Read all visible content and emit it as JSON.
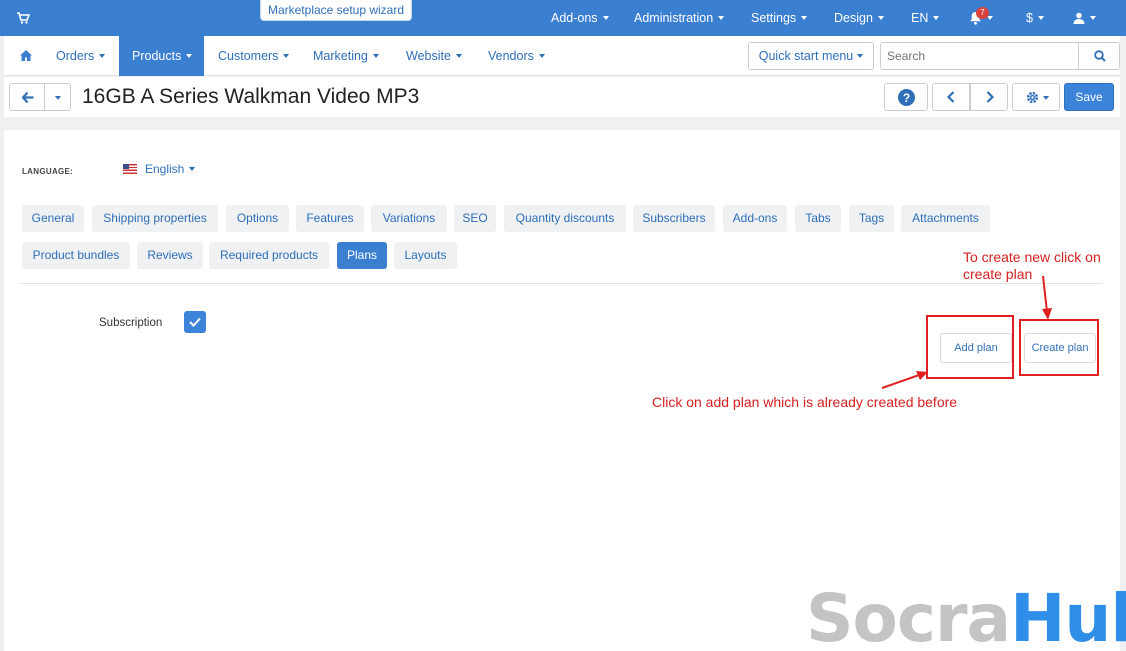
{
  "topbar": {
    "wizard_label": "Marketplace setup wizard",
    "items": [
      "Add-ons",
      "Administration",
      "Settings",
      "Design",
      "EN"
    ],
    "notification_count": "7",
    "currency_label": "$"
  },
  "mainnav": {
    "items": [
      "Orders",
      "Products",
      "Customers",
      "Marketing",
      "Website",
      "Vendors"
    ],
    "quick_start": "Quick start menu",
    "search_placeholder": "Search"
  },
  "titlebar": {
    "title": "16GB A Series Walkman Video MP3",
    "save_label": "Save"
  },
  "content": {
    "language_label": "LANGUAGE:",
    "language_value": "English",
    "tabs_row1": [
      "General",
      "Shipping properties",
      "Options",
      "Features",
      "Variations",
      "SEO",
      "Quantity discounts",
      "Subscribers",
      "Add-ons",
      "Tabs",
      "Tags",
      "Attachments"
    ],
    "tabs_row2": [
      "Product bundles",
      "Reviews",
      "Required products",
      "Plans",
      "Layouts"
    ],
    "active_tab": "Plans",
    "subscription_label": "Subscription",
    "subscription_checked": true,
    "add_plan_label": "Add plan",
    "create_plan_label": "Create plan"
  },
  "annotations": {
    "create_note_line1": "To create new click on",
    "create_note_line2": "create plan",
    "add_note": "Click on add plan which is already created before"
  },
  "watermark": {
    "part1": "Socra",
    "part2": "Hub"
  },
  "colors": {
    "accent": "#3b7fd0",
    "annotation": "#e02020",
    "watermark_gray": "#c4c4c4",
    "watermark_blue": "#2f8fe8"
  }
}
